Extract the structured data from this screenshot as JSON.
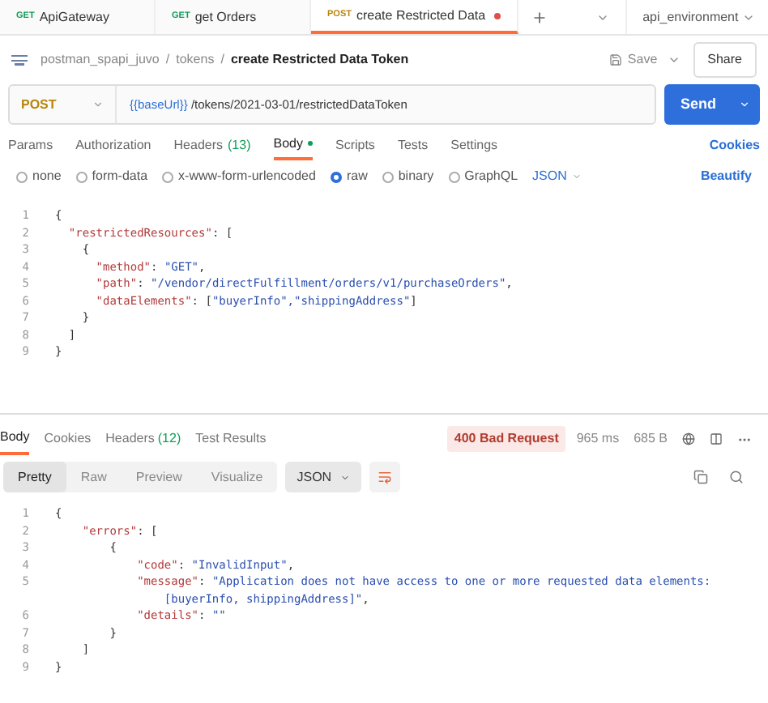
{
  "tabs": [
    {
      "method": "GET",
      "label": "ApiGateway",
      "selected": false,
      "unsaved": false
    },
    {
      "method": "GET",
      "label": "get Orders",
      "selected": false,
      "unsaved": false
    },
    {
      "method": "POST",
      "label": "create Restricted Data",
      "selected": true,
      "unsaved": true
    }
  ],
  "environment": "api_environment",
  "breadcrumb": [
    "postman_spapi_juvo",
    "tokens"
  ],
  "breadcrumb_separator": "/",
  "request_title": "create Restricted Data Token",
  "save_label": "Save",
  "share_label": "Share",
  "method": "POST",
  "url": {
    "variable": "{{baseUrl}}",
    "path": " /tokens/2021-03-01/restrictedDataToken"
  },
  "send_label": "Send",
  "request_tabs": [
    {
      "label": "Params",
      "selected": false,
      "dot": false
    },
    {
      "label": "Authorization",
      "selected": false,
      "dot": false
    },
    {
      "label": "Headers",
      "count": "(13)",
      "selected": false,
      "dot": false
    },
    {
      "label": "Body",
      "selected": true,
      "dot": true
    },
    {
      "label": "Scripts",
      "selected": false,
      "dot": false
    },
    {
      "label": "Tests",
      "selected": false,
      "dot": false
    },
    {
      "label": "Settings",
      "selected": false,
      "dot": false
    }
  ],
  "cookies_label": "Cookies",
  "body_types": [
    {
      "label": "none",
      "selected": false
    },
    {
      "label": "form-data",
      "selected": false
    },
    {
      "label": "x-www-form-urlencoded",
      "selected": false
    },
    {
      "label": "raw",
      "selected": true
    },
    {
      "label": "binary",
      "selected": false
    },
    {
      "label": "GraphQL",
      "selected": false
    }
  ],
  "body_format": "JSON",
  "beautify_label": "Beautify",
  "request_body": [
    {
      "number": "1",
      "tokens": [
        {
          "kind": "punct",
          "text": "{"
        }
      ]
    },
    {
      "number": "2",
      "tokens": [
        {
          "kind": "key",
          "text": "  \"restrictedResources\""
        },
        {
          "kind": "punct",
          "text": ": ["
        }
      ]
    },
    {
      "number": "3",
      "tokens": [
        {
          "kind": "punct",
          "text": "    {"
        }
      ]
    },
    {
      "number": "4",
      "tokens": [
        {
          "kind": "key",
          "text": "      \"method\""
        },
        {
          "kind": "punct",
          "text": ": "
        },
        {
          "kind": "string",
          "text": "\"GET\""
        },
        {
          "kind": "punct",
          "text": ","
        }
      ]
    },
    {
      "number": "5",
      "tokens": [
        {
          "kind": "key",
          "text": "      \"path\""
        },
        {
          "kind": "punct",
          "text": ": "
        },
        {
          "kind": "string",
          "text": "\"/vendor/directFulfillment/orders/v1/purchaseOrders\""
        },
        {
          "kind": "punct",
          "text": ","
        }
      ]
    },
    {
      "number": "6",
      "tokens": [
        {
          "kind": "key",
          "text": "      \"dataElements\""
        },
        {
          "kind": "punct",
          "text": ": ["
        },
        {
          "kind": "string",
          "text": "\"buyerInfo\",\"shippingAddress\""
        },
        {
          "kind": "punct",
          "text": "]"
        }
      ]
    },
    {
      "number": "7",
      "tokens": [
        {
          "kind": "punct",
          "text": "    }"
        }
      ]
    },
    {
      "number": "8",
      "tokens": [
        {
          "kind": "punct",
          "text": "  ]"
        }
      ]
    },
    {
      "number": "9",
      "tokens": [
        {
          "kind": "punct",
          "text": "}"
        }
      ]
    }
  ],
  "response_tabs": [
    {
      "label": "Body",
      "selected": true
    },
    {
      "label": "Cookies",
      "selected": false
    },
    {
      "label": "Headers",
      "count": "(12)",
      "selected": false
    },
    {
      "label": "Test Results",
      "selected": false
    }
  ],
  "status": "400 Bad Request",
  "time": "965 ms",
  "size": "685 B",
  "view_modes": [
    {
      "label": "Pretty",
      "selected": true
    },
    {
      "label": "Raw",
      "selected": false
    },
    {
      "label": "Preview",
      "selected": false
    },
    {
      "label": "Visualize",
      "selected": false
    }
  ],
  "response_format": "JSON",
  "response_body": [
    {
      "number": "1",
      "tokens": [
        {
          "kind": "punct",
          "text": "{"
        }
      ]
    },
    {
      "number": "2",
      "tokens": [
        {
          "kind": "key",
          "text": "    \"errors\""
        },
        {
          "kind": "punct",
          "text": ": ["
        }
      ]
    },
    {
      "number": "3",
      "tokens": [
        {
          "kind": "punct",
          "text": "        {"
        }
      ]
    },
    {
      "number": "4",
      "tokens": [
        {
          "kind": "key",
          "text": "            \"code\""
        },
        {
          "kind": "punct",
          "text": ": "
        },
        {
          "kind": "string",
          "text": "\"InvalidInput\""
        },
        {
          "kind": "punct",
          "text": ","
        }
      ]
    },
    {
      "number": "5",
      "tokens": [
        {
          "kind": "key",
          "text": "            \"message\""
        },
        {
          "kind": "punct",
          "text": ": "
        },
        {
          "kind": "string",
          "text": "\"Application does not have access to one or more requested data elements:"
        }
      ],
      "continuation": [
        {
          "kind": "string",
          "text": "                [buyerInfo, shippingAddress]\""
        },
        {
          "kind": "punct",
          "text": ","
        }
      ]
    },
    {
      "number": "6",
      "tokens": [
        {
          "kind": "key",
          "text": "            \"details\""
        },
        {
          "kind": "punct",
          "text": ": "
        },
        {
          "kind": "string",
          "text": "\"\""
        }
      ]
    },
    {
      "number": "7",
      "tokens": [
        {
          "kind": "punct",
          "text": "        }"
        }
      ]
    },
    {
      "number": "8",
      "tokens": [
        {
          "kind": "punct",
          "text": "    ]"
        }
      ]
    },
    {
      "number": "9",
      "tokens": [
        {
          "kind": "punct",
          "text": "}"
        }
      ]
    }
  ]
}
